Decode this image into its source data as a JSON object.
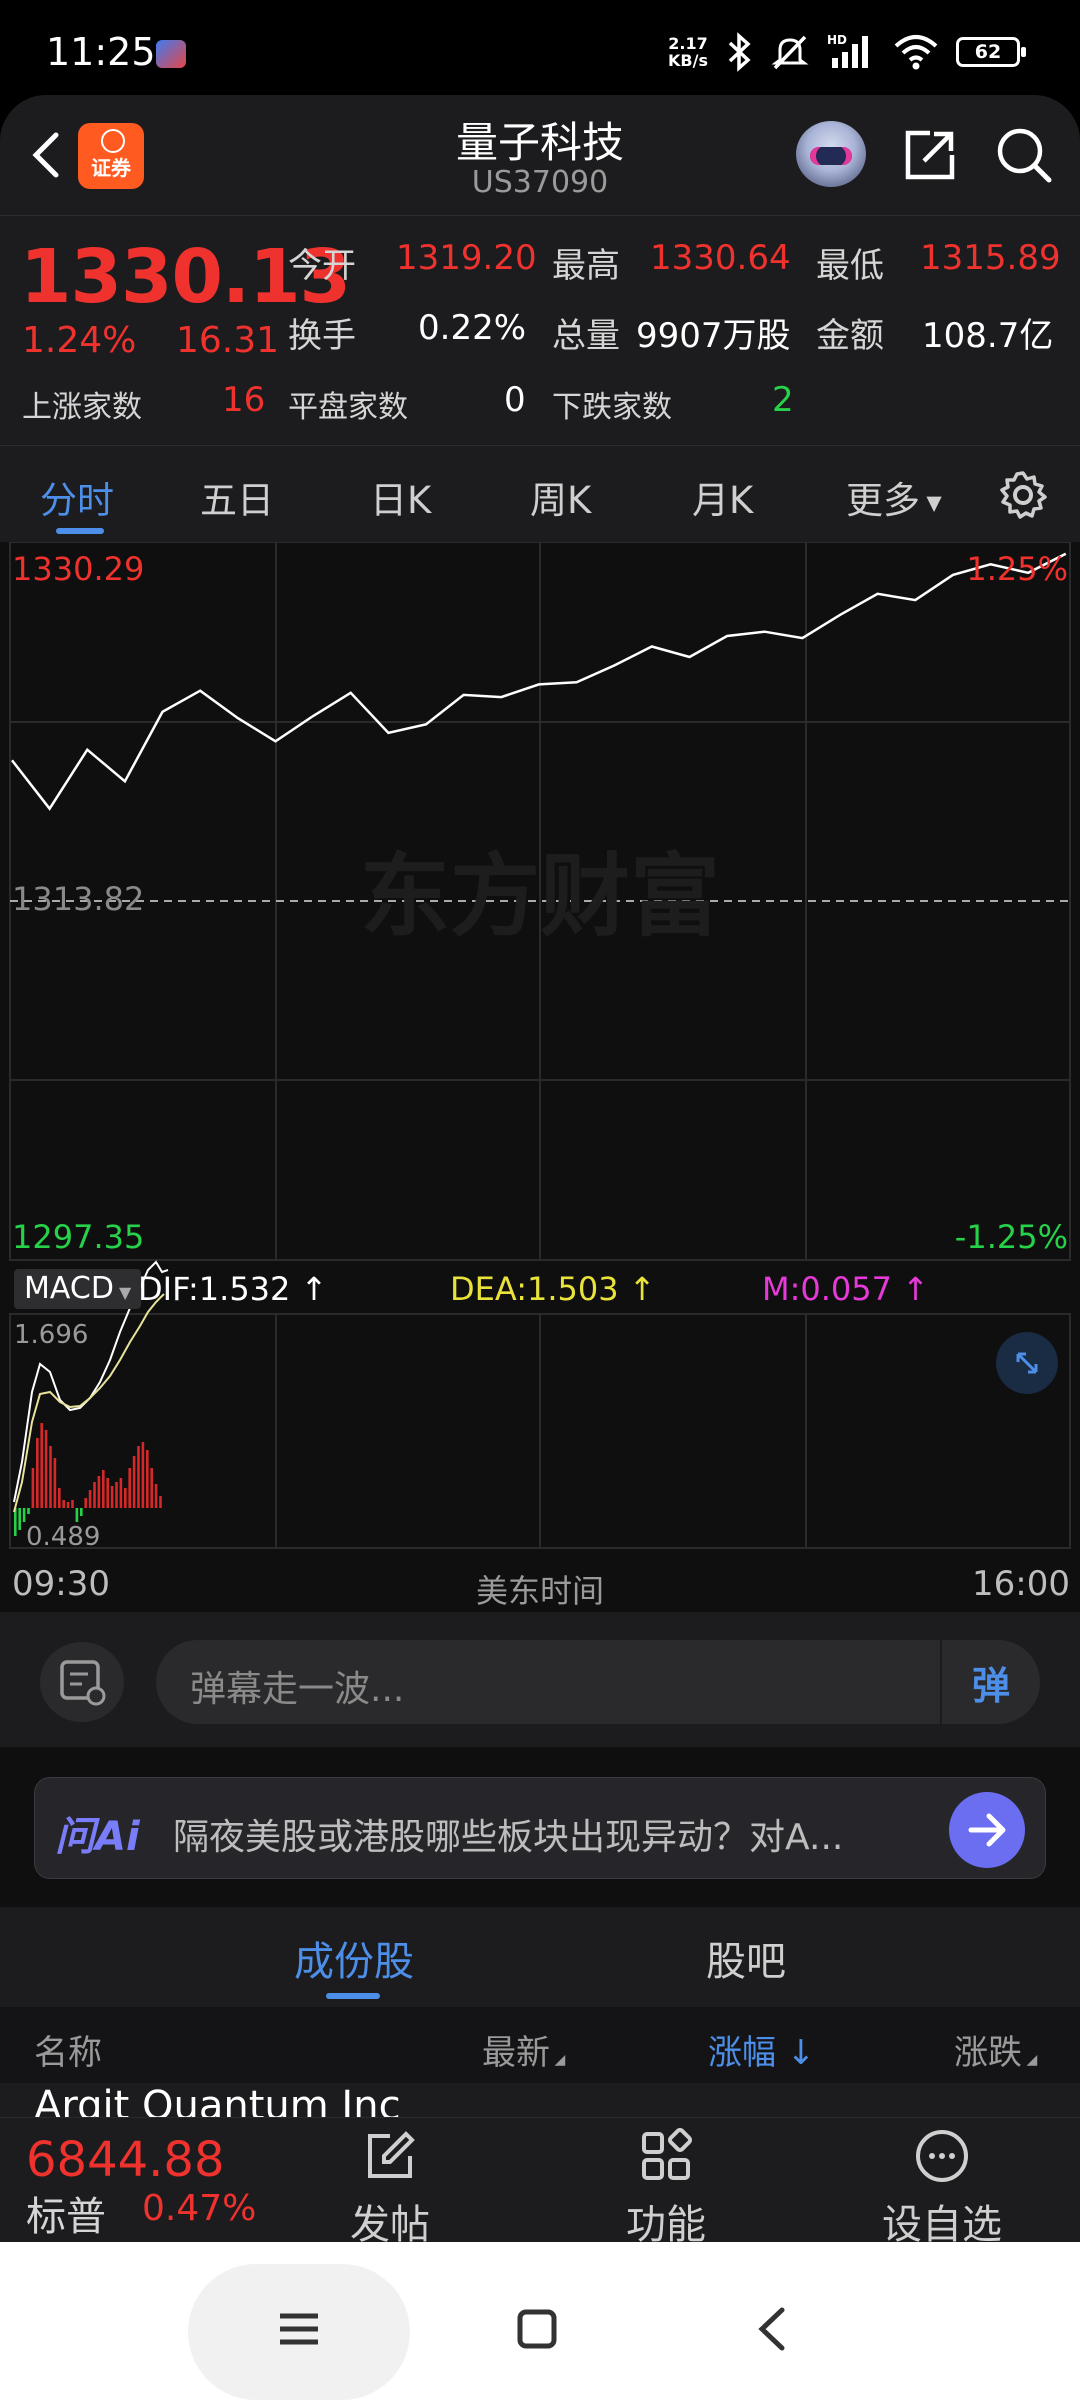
{
  "status_bar": {
    "time": "11:25",
    "net_speed_top": "2.17",
    "net_speed_unit": "KB/s",
    "signal_tag": "HD",
    "battery": "62"
  },
  "header": {
    "badge_label": "证券",
    "title": "量子科技",
    "code": "US37090"
  },
  "quote": {
    "price": "1330.13",
    "change_pct": "1.24%",
    "change": "16.31",
    "open_label": "今开",
    "open": "1319.20",
    "high_label": "最高",
    "high": "1330.64",
    "low_label": "最低",
    "low": "1315.89",
    "turnover_label": "换手",
    "turnover": "0.22%",
    "volume_label": "总量",
    "volume": "9907万股",
    "amount_label": "金额",
    "amount": "108.7亿",
    "up_label": "上涨家数",
    "up": "16",
    "flat_label": "平盘家数",
    "flat": "0",
    "down_label": "下跌家数",
    "down": "2"
  },
  "tabs": [
    "分时",
    "五日",
    "日K",
    "周K",
    "月K",
    "更多"
  ],
  "chart": {
    "top_price": "1330.29",
    "top_pct": "1.25%",
    "mid_price": "1313.82",
    "bottom_price": "1297.35",
    "bottom_pct": "-1.25%",
    "watermark": "东方财富",
    "macd_select": "MACD",
    "dif": "DIF:1.532",
    "dea": "DEA:1.503",
    "m": "M:0.057",
    "macd_top": "1.696",
    "macd_bottom": "0.489",
    "time_start": "09:30",
    "time_mid": "美东时间",
    "time_end": "16:00"
  },
  "chart_data": {
    "type": "line",
    "y_range": [
      1297.35,
      1330.29
    ],
    "baseline": 1313.82,
    "price_points": [
      [
        0,
        1320.5
      ],
      [
        1,
        1318.2
      ],
      [
        2,
        1321
      ],
      [
        3,
        1319.5
      ],
      [
        4,
        1322.8
      ],
      [
        5,
        1323.8
      ],
      [
        6,
        1322.5
      ],
      [
        7,
        1321.4
      ],
      [
        8,
        1322.6
      ],
      [
        9,
        1323.7
      ],
      [
        10,
        1321.8
      ],
      [
        11,
        1322.2
      ],
      [
        12,
        1323.6
      ],
      [
        13,
        1323.5
      ],
      [
        14,
        1324.1
      ],
      [
        15,
        1324.2
      ],
      [
        16,
        1325
      ],
      [
        17,
        1325.9
      ],
      [
        18,
        1325.4
      ],
      [
        19,
        1326.4
      ],
      [
        20,
        1326.6
      ],
      [
        21,
        1326.3
      ],
      [
        22,
        1327.4
      ],
      [
        23,
        1328.4
      ],
      [
        24,
        1328.1
      ],
      [
        25,
        1329.3
      ],
      [
        26,
        1329.8
      ],
      [
        27,
        1329.4
      ],
      [
        28,
        1330.3
      ]
    ],
    "total_minutes": 390
  },
  "danmaku": {
    "placeholder": "弹幕走一波...",
    "button": "弹"
  },
  "ask_ai": {
    "logo": "问Ai",
    "text": "隔夜美股或港股哪些板块出现异动？对A..."
  },
  "constituents": {
    "tabs": [
      "成份股",
      "股吧"
    ],
    "col_name": "名称",
    "col_latest": "最新",
    "col_pct": "涨幅",
    "col_change": "涨跌",
    "first_row_name": "Arqit Quantum Inc"
  },
  "bottom_bar": {
    "index_value": "6844.88",
    "index_name": "标普",
    "index_pct": "0.47%",
    "post_label": "发帖",
    "func_label": "功能",
    "watch_label": "设自选"
  }
}
